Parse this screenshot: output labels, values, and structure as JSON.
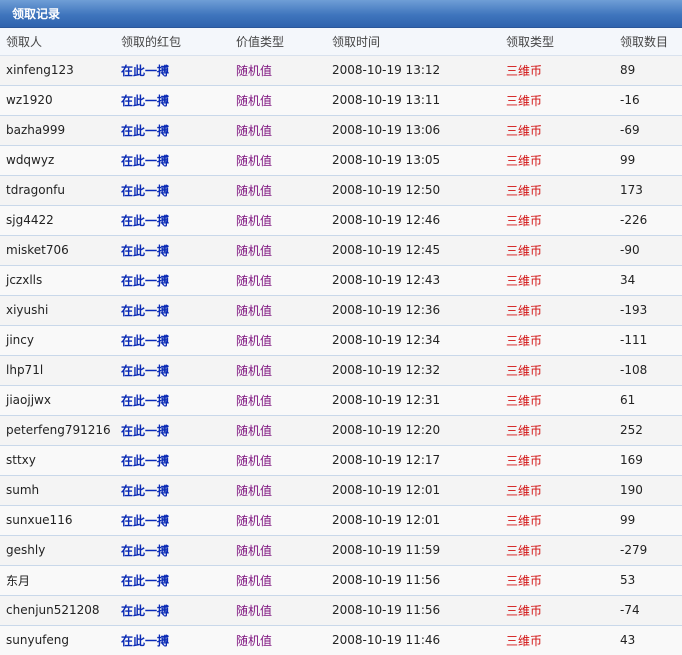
{
  "title": "领取记录",
  "columns": [
    "领取人",
    "领取的红包",
    "价值类型",
    "领取时间",
    "领取类型",
    "领取数目"
  ],
  "rows": [
    {
      "user": "xinfeng123",
      "packet": "在此一搏",
      "value_type": "随机值",
      "time": "2008-10-19 13:12",
      "claim_type": "三维币",
      "amount": "89"
    },
    {
      "user": "wz1920",
      "packet": "在此一搏",
      "value_type": "随机值",
      "time": "2008-10-19 13:11",
      "claim_type": "三维币",
      "amount": "-16"
    },
    {
      "user": "bazha999",
      "packet": "在此一搏",
      "value_type": "随机值",
      "time": "2008-10-19 13:06",
      "claim_type": "三维币",
      "amount": "-69"
    },
    {
      "user": "wdqwyz",
      "packet": "在此一搏",
      "value_type": "随机值",
      "time": "2008-10-19 13:05",
      "claim_type": "三维币",
      "amount": "99"
    },
    {
      "user": "tdragonfu",
      "packet": "在此一搏",
      "value_type": "随机值",
      "time": "2008-10-19 12:50",
      "claim_type": "三维币",
      "amount": "173"
    },
    {
      "user": "sjg4422",
      "packet": "在此一搏",
      "value_type": "随机值",
      "time": "2008-10-19 12:46",
      "claim_type": "三维币",
      "amount": "-226"
    },
    {
      "user": "misket706",
      "packet": "在此一搏",
      "value_type": "随机值",
      "time": "2008-10-19 12:45",
      "claim_type": "三维币",
      "amount": "-90"
    },
    {
      "user": "jczxlls",
      "packet": "在此一搏",
      "value_type": "随机值",
      "time": "2008-10-19 12:43",
      "claim_type": "三维币",
      "amount": "34"
    },
    {
      "user": "xiyushi",
      "packet": "在此一搏",
      "value_type": "随机值",
      "time": "2008-10-19 12:36",
      "claim_type": "三维币",
      "amount": "-193"
    },
    {
      "user": "jincy",
      "packet": "在此一搏",
      "value_type": "随机值",
      "time": "2008-10-19 12:34",
      "claim_type": "三维币",
      "amount": "-111"
    },
    {
      "user": "lhp71l",
      "packet": "在此一搏",
      "value_type": "随机值",
      "time": "2008-10-19 12:32",
      "claim_type": "三维币",
      "amount": "-108"
    },
    {
      "user": "jiaojjwx",
      "packet": "在此一搏",
      "value_type": "随机值",
      "time": "2008-10-19 12:31",
      "claim_type": "三维币",
      "amount": "61"
    },
    {
      "user": "peterfeng791216",
      "packet": "在此一搏",
      "value_type": "随机值",
      "time": "2008-10-19 12:20",
      "claim_type": "三维币",
      "amount": "252"
    },
    {
      "user": "sttxy",
      "packet": "在此一搏",
      "value_type": "随机值",
      "time": "2008-10-19 12:17",
      "claim_type": "三维币",
      "amount": "169"
    },
    {
      "user": "sumh",
      "packet": "在此一搏",
      "value_type": "随机值",
      "time": "2008-10-19 12:01",
      "claim_type": "三维币",
      "amount": "190"
    },
    {
      "user": "sunxue116",
      "packet": "在此一搏",
      "value_type": "随机值",
      "time": "2008-10-19 12:01",
      "claim_type": "三维币",
      "amount": "99"
    },
    {
      "user": "geshly",
      "packet": "在此一搏",
      "value_type": "随机值",
      "time": "2008-10-19 11:59",
      "claim_type": "三维币",
      "amount": "-279"
    },
    {
      "user": "东月",
      "packet": "在此一搏",
      "value_type": "随机值",
      "time": "2008-10-19 11:56",
      "claim_type": "三维币",
      "amount": "53"
    },
    {
      "user": "chenjun521208",
      "packet": "在此一搏",
      "value_type": "随机值",
      "time": "2008-10-19 11:56",
      "claim_type": "三维币",
      "amount": "-74"
    },
    {
      "user": "sunyufeng",
      "packet": "在此一搏",
      "value_type": "随机值",
      "time": "2008-10-19 11:46",
      "claim_type": "三维币",
      "amount": "43"
    }
  ],
  "colors": {
    "title_bar": "#3f75bd",
    "packet_link": "#0a2ab5",
    "value_type": "#7c0f7d",
    "claim_type": "#d21111"
  }
}
